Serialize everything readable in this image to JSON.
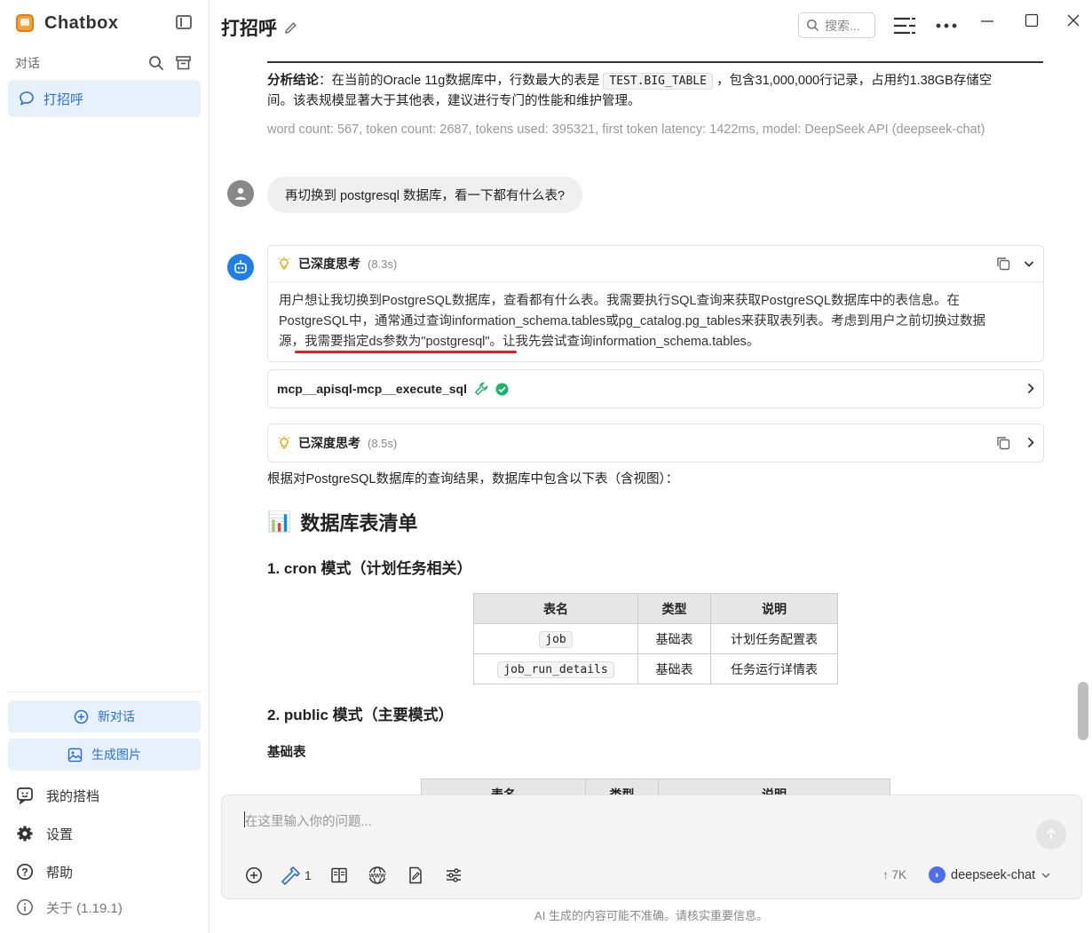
{
  "app": {
    "name": "Chatbox",
    "title": "打招呼"
  },
  "sidebar": {
    "section_label": "对话",
    "conversations": [
      {
        "label": "打招呼"
      }
    ],
    "new_chat_label": "新对话",
    "gen_image_label": "生成图片",
    "links": [
      {
        "label": "我的搭档"
      },
      {
        "label": "设置"
      },
      {
        "label": "帮助"
      },
      {
        "label": "关于 (1.19.1)"
      }
    ]
  },
  "header": {
    "search_placeholder": "搜索..."
  },
  "messages": {
    "prev_conclusion": {
      "label": "分析结论",
      "text_before": "：在当前的Oracle 11g数据库中，行数最大的表是",
      "code": "TEST.BIG_TABLE",
      "text_after": "，包含31,000,000行记录，占用约1.38GB存储空",
      "text_line2": "间。该表规模显著大于其他表，建议进行专门的性能和维护管理。",
      "meta": "word count: 567, token count: 2687, tokens used: 395321, first token latency: 1422ms, model: DeepSeek API (deepseek-chat)"
    },
    "user": {
      "text": "再切换到 postgresql 数据库，看一下都有什么表?"
    },
    "thinking1": {
      "title": "已深度思考",
      "time": "(8.3s)",
      "line1": "用户想让我切换到PostgreSQL数据库，查看都有什么表。我需要执行SQL查询来获取PostgreSQL数据库中的表信息。在",
      "line2": "PostgreSQL中，通常通过查询information_schema.tables或pg_catalog.pg_tables来获取表列表。考虑到用户之前切换过数据",
      "line3": "源，我需要指定ds参数为\"postgresql\"。让我先尝试查询information_schema.tables。"
    },
    "tool_call": {
      "name": "mcp__apisql-mcp__execute_sql"
    },
    "thinking2": {
      "title": "已深度思考",
      "time": "(8.5s)"
    },
    "answer": {
      "intro": "根据对PostgreSQL数据库的查询结果，数据库中包含以下表（含视图）：",
      "h2": "数据库表清单",
      "h2_icon": "📊",
      "section1": "1. cron 模式（计划任务相关）",
      "table1": {
        "headers": [
          "表名",
          "类型",
          "说明"
        ],
        "rows": [
          [
            "job",
            "基础表",
            "计划任务配置表"
          ],
          [
            "job_run_details",
            "基础表",
            "任务运行详情表"
          ]
        ]
      },
      "section2": "2. public 模式（主要模式）",
      "subsection": "基础表",
      "table2": {
        "headers": [
          "表名",
          "类型",
          "说明"
        ]
      }
    }
  },
  "input": {
    "placeholder": "在这里输入你的问题...",
    "tool_count": "1",
    "tokens": "7K",
    "model": "deepseek-chat"
  },
  "disclaimer": "AI 生成的内容可能不准确。请核实重要信息。",
  "colors": {
    "accent": "#2a6fd6",
    "accent_bg": "#e7f1fb",
    "underline": "#e02020",
    "check": "#12b76a"
  }
}
